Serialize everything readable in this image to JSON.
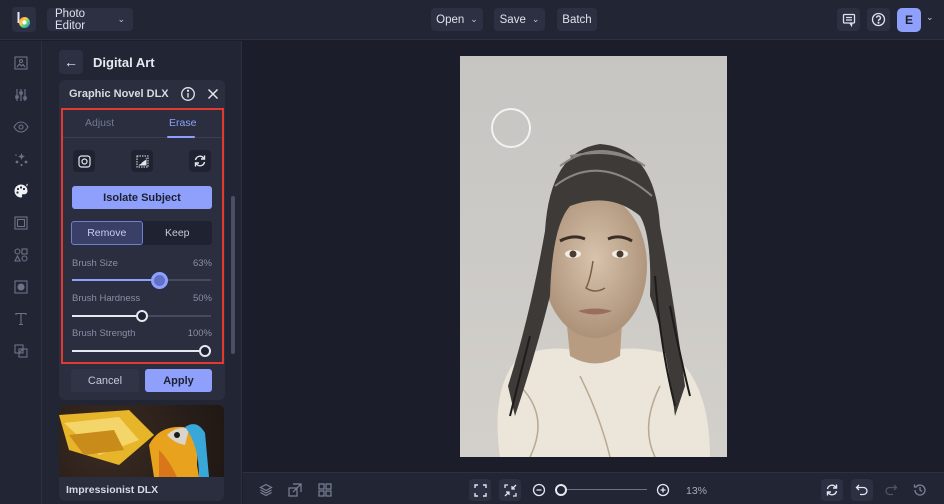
{
  "topbar": {
    "app_menu_label": "Photo Editor",
    "open_label": "Open",
    "save_label": "Save",
    "batch_label": "Batch",
    "avatar_initial": "E",
    "icons": [
      "logo-icon",
      "comment-icon",
      "help-icon",
      "chevron-down-icon"
    ]
  },
  "rail": {
    "items": [
      {
        "name": "image",
        "icon": "image-icon",
        "active": false
      },
      {
        "name": "adjust",
        "icon": "sliders-icon",
        "active": false
      },
      {
        "name": "effects",
        "icon": "eye-icon",
        "active": false
      },
      {
        "name": "touch-up",
        "icon": "sparkle-icon",
        "active": false
      },
      {
        "name": "artsy",
        "icon": "palette-icon",
        "active": true
      },
      {
        "name": "frames",
        "icon": "frame-icon",
        "active": false
      },
      {
        "name": "graphics",
        "icon": "shapes-icon",
        "active": false
      },
      {
        "name": "textures",
        "icon": "texture-icon",
        "active": false
      },
      {
        "name": "text",
        "icon": "text-icon",
        "active": false
      },
      {
        "name": "overlays",
        "icon": "overlay-icon",
        "active": false
      }
    ]
  },
  "panel": {
    "title": "Digital Art",
    "card": {
      "title": "Graphic Novel DLX",
      "tabs": [
        {
          "label": "Adjust",
          "active": false
        },
        {
          "label": "Erase",
          "active": true
        }
      ],
      "tools": [
        "brush-mode-icon",
        "invert-mask-icon",
        "reset-icon"
      ],
      "isolate_label": "Isolate Subject",
      "mode": {
        "options": [
          "Remove",
          "Keep"
        ],
        "selected": "Remove"
      },
      "sliders": [
        {
          "label": "Brush Size",
          "value": 63,
          "display": "63%"
        },
        {
          "label": "Brush Hardness",
          "value": 50,
          "display": "50%"
        },
        {
          "label": "Brush Strength",
          "value": 100,
          "display": "100%"
        }
      ],
      "cancel_label": "Cancel",
      "apply_label": "Apply"
    },
    "next_preset": {
      "label": "Impressionist DLX"
    }
  },
  "canvas": {
    "zoom_percent": 13,
    "zoom_display": "13%"
  },
  "bottombar": {
    "left_icons": [
      "layers-icon",
      "replace-image-icon",
      "grid-icon"
    ],
    "view_icons": [
      "fit-screen-icon",
      "actual-size-icon"
    ],
    "right_icons": [
      "sync-icon",
      "undo-icon",
      "redo-icon",
      "history-icon"
    ]
  },
  "colors": {
    "accent": "#8ea0fb",
    "highlight_border": "#e23a2e",
    "background": "#1b1e2a",
    "panel": "#222534"
  }
}
